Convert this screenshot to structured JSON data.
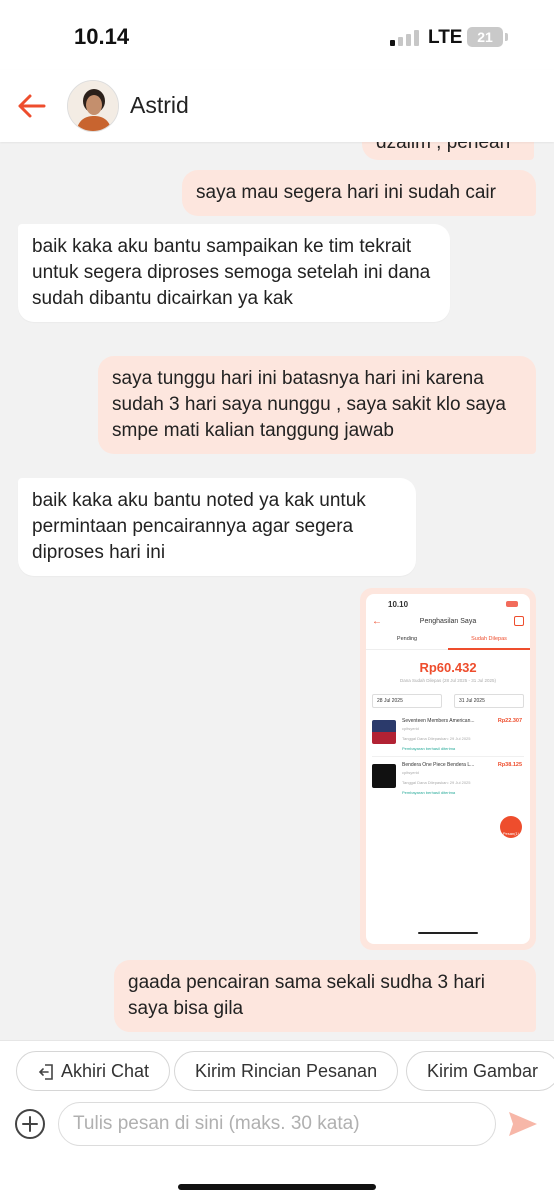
{
  "status_bar": {
    "time": "10.14",
    "network": "LTE",
    "battery": "21"
  },
  "header": {
    "contact_name": "Astrid"
  },
  "messages": [
    {
      "side": "out",
      "text": "dzalim , penean"
    },
    {
      "side": "out",
      "text": "saya mau segera hari ini sudah cair"
    },
    {
      "side": "in",
      "text": "baik kaka aku bantu sampaikan ke tim tekrait untuk segera diproses semoga setelah ini dana sudah dibantu dicairkan ya kak"
    },
    {
      "side": "out",
      "text": "saya tunggu hari ini batasnya hari ini karena sudah 3 hari saya nunggu , saya sakit klo saya smpe mati kalian tanggung jawab"
    },
    {
      "side": "in",
      "text": "baik kaka aku bantu noted ya kak untuk permintaan pencairannya agar segera diproses hari ini"
    },
    {
      "side": "out",
      "text": "gaada pencairan sama sekali sudha 3 hari saya bisa gila"
    }
  ],
  "screenshot": {
    "time": "10.10",
    "title": "Penghasilan Saya",
    "tabs": [
      "Pending",
      "Sudah Dilepas"
    ],
    "amount": "Rp60.432",
    "period": "Dana Sudah Dilepas (28 Jul 2025 - 31 Jul 2025)",
    "date_from": "28 Jul 2025",
    "date_to": "31 Jul 2025",
    "items": [
      {
        "name": "Seventeen Members American...",
        "buyer": "cpltsyerid",
        "price": "Rp22.307",
        "date": "Tanggal Dana Dilepaskan: 29 Jul 2025",
        "status": "Pembayaran berhasil diterima"
      },
      {
        "name": "Bendera One Piece Bendera L...",
        "buyer": "cpltsyerid",
        "price": "Rp38.125",
        "date": "Tanggal Dana Dilepaskan: 29 Jul 2025",
        "status": "Pembayaran berhasil diterima"
      }
    ],
    "fab_label": "Pesan(1)"
  },
  "quick_replies": [
    "Akhiri Chat",
    "Kirim Rincian Pesanan",
    "Kirim Gambar"
  ],
  "input": {
    "placeholder": "Tulis pesan di sini (maks. 30 kata)"
  },
  "colors": {
    "accent": "#ee4d2d",
    "bubble_out": "#fde6de",
    "bubble_in": "#ffffff",
    "background": "#f2f2f2"
  }
}
